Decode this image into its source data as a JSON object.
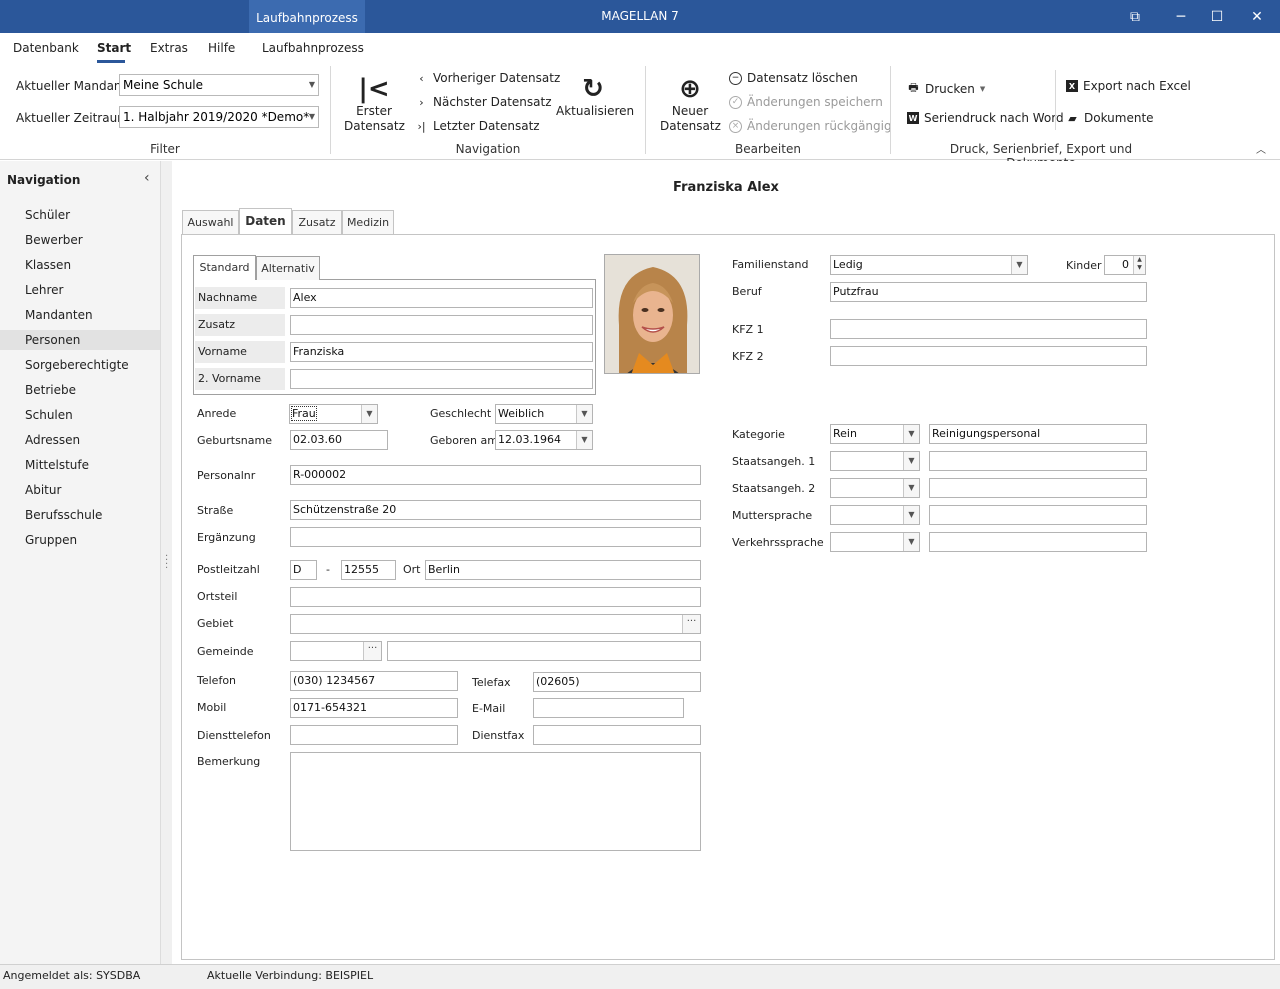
{
  "window": {
    "context_tab": "Laufbahnprozess",
    "title": "MAGELLAN 7"
  },
  "menu": [
    "Datenbank",
    "Start",
    "Extras",
    "Hilfe",
    "Laufbahnprozess"
  ],
  "filter": {
    "mandant_label": "Aktueller Mandant",
    "mandant_value": "Meine Schule",
    "zeitraum_label": "Aktueller Zeitraum",
    "zeitraum_value": "1. Halbjahr 2019/2020 *Demo*",
    "group_label": "Filter"
  },
  "navigation_group": {
    "first_label_1": "Erster",
    "first_label_2": "Datensatz",
    "prev": "Vorheriger Datensatz",
    "next": "Nächster Datensatz",
    "last": "Letzter Datensatz",
    "refresh": "Aktualisieren",
    "group_label": "Navigation"
  },
  "edit_group": {
    "new_label_1": "Neuer",
    "new_label_2": "Datensatz",
    "delete": "Datensatz löschen",
    "save": "Änderungen speichern",
    "undo": "Änderungen rückgängig",
    "group_label": "Bearbeiten"
  },
  "print_group": {
    "print": "Drucken",
    "serial": "Seriendruck nach Word",
    "excel": "Export nach Excel",
    "docs": "Dokumente",
    "group_label": "Druck, Serienbrief, Export und Dokumente"
  },
  "sidebar": {
    "title": "Navigation",
    "items": [
      "Schüler",
      "Bewerber",
      "Klassen",
      "Lehrer",
      "Mandanten",
      "Personen",
      "Sorgeberechtigte",
      "Betriebe",
      "Schulen",
      "Adressen",
      "Mittelstufe",
      "Abitur",
      "Berufsschule",
      "Gruppen"
    ],
    "selected": "Personen"
  },
  "record": {
    "title": "Franziska Alex",
    "tabs": [
      "Auswahl",
      "Daten",
      "Zusatz",
      "Medizin"
    ],
    "inner_tabs": [
      "Standard",
      "Alternativ"
    ]
  },
  "form": {
    "nachname_label": "Nachname",
    "nachname": "Alex",
    "zusatz_label": "Zusatz",
    "zusatz": "",
    "vorname_label": "Vorname",
    "vorname": "Franziska",
    "vorname2_label": "2. Vorname",
    "vorname2": "",
    "anrede_label": "Anrede",
    "anrede": "Frau",
    "geschlecht_label": "Geschlecht",
    "geschlecht": "Weiblich",
    "geburtsname_label": "Geburtsname",
    "geburtsname": "02.03.60",
    "geboren_label": "Geboren am",
    "geboren": "12.03.1964",
    "personalnr_label": "Personalnr",
    "personalnr": "R-000002",
    "strasse_label": "Straße",
    "strasse": "Schützenstraße 20",
    "ergaenzung_label": "Ergänzung",
    "ergaenzung": "",
    "plz_label": "Postleitzahl",
    "land": "D",
    "dash": "-",
    "plz": "12555",
    "ort_label": "Ort",
    "ort": "Berlin",
    "ortsteil_label": "Ortsteil",
    "ortsteil": "",
    "gebiet_label": "Gebiet",
    "gebiet": "",
    "gemeinde_label": "Gemeinde",
    "gemeinde": "",
    "telefon_label": "Telefon",
    "telefon": "(030) 1234567",
    "telefax_label": "Telefax",
    "telefax": "(02605)",
    "mobil_label": "Mobil",
    "mobil": "0171-654321",
    "email_label": "E-Mail",
    "email": "",
    "diensttel_label": "Diensttelefon",
    "diensttel": "",
    "dienstfax_label": "Dienstfax",
    "dienstfax": "",
    "bemerkung_label": "Bemerkung",
    "bemerkung": "",
    "familienstand_label": "Familienstand",
    "familienstand": "Ledig",
    "kinder_label": "Kinder",
    "kinder": "0",
    "beruf_label": "Beruf",
    "beruf": "Putzfrau",
    "kfz1_label": "KFZ 1",
    "kfz1": "",
    "kfz2_label": "KFZ 2",
    "kfz2": "",
    "kategorie_label": "Kategorie",
    "kategorie": "Rein",
    "kategorie_text": "Reinigungspersonal",
    "staat1_label": "Staatsangeh. 1",
    "staat2_label": "Staatsangeh. 2",
    "mutter_label": "Muttersprache",
    "verkehr_label": "Verkehrssprache"
  },
  "status": {
    "user": "Angemeldet als: SYSDBA",
    "connection": "Aktuelle Verbindung: BEISPIEL"
  },
  "colors": {
    "titlebar": "#2b579a",
    "accent": "#2b579a"
  }
}
